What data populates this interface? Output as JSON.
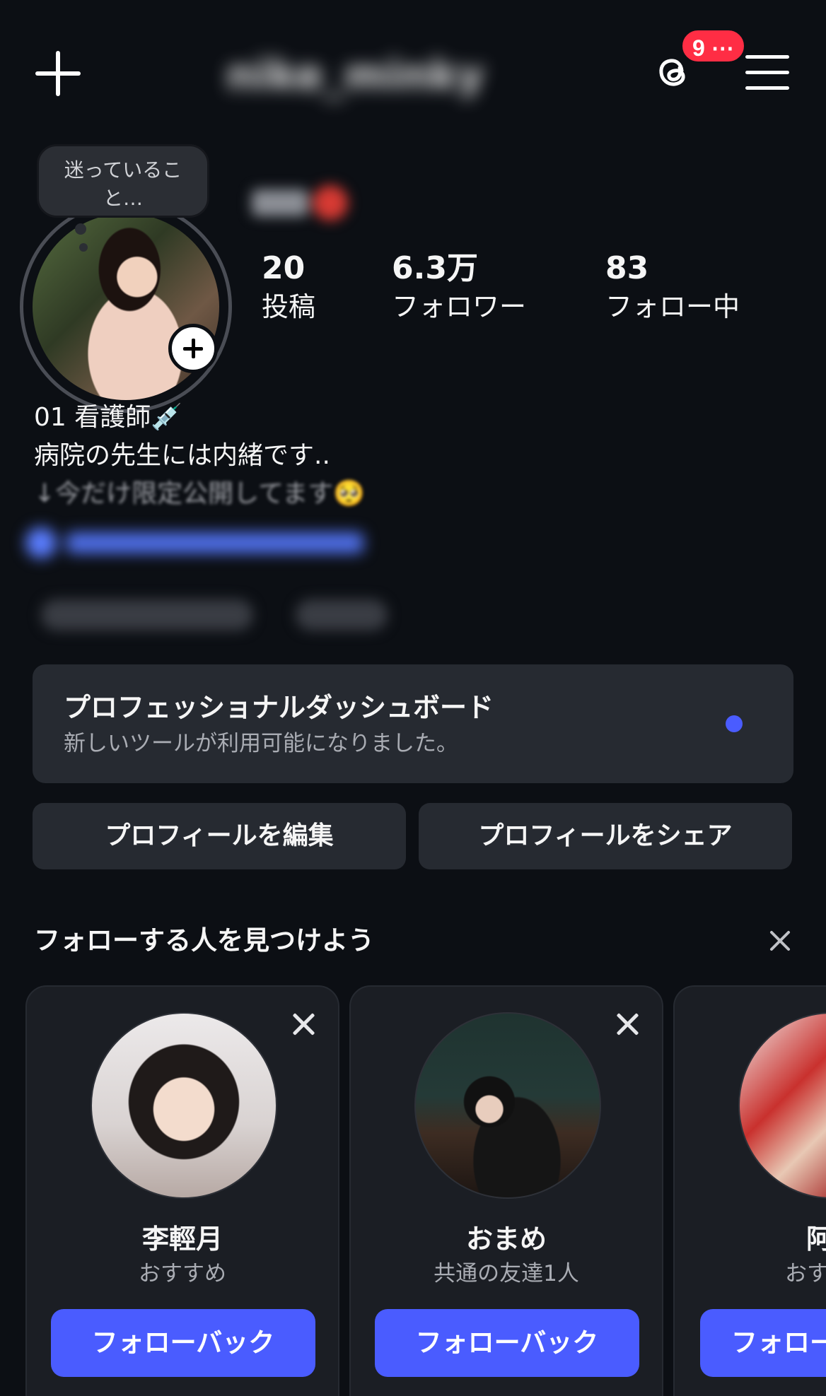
{
  "header": {
    "username": "nike_minky",
    "notification_count": "9 ⋯",
    "icons": {
      "create": "plus-icon",
      "threads": "threads-icon",
      "menu": "hamburger-menu-icon"
    }
  },
  "profile": {
    "note_text": "迷っていること…",
    "display_name": "優衣",
    "stats": [
      {
        "value": "20",
        "label": "投稿"
      },
      {
        "value": "6.3万",
        "label": "フォロワー"
      },
      {
        "value": "83",
        "label": "フォロー中"
      }
    ],
    "bio": {
      "line1": "01 看護師💉",
      "line2": "病院の先生には内緒です..",
      "line3": "↓今だけ限定公開してます🥺"
    }
  },
  "dashboard": {
    "title": "プロフェッショナルダッシュボード",
    "subtitle": "新しいツールが利用可能になりました。",
    "dot_color": "#4a5cff"
  },
  "actions": {
    "edit_profile": "プロフィールを編集",
    "share_profile": "プロフィールをシェア"
  },
  "suggestions": {
    "title": "フォローする人を見つけよう",
    "cards": [
      {
        "name": "李輕月",
        "subtitle": "おすすめ",
        "button": "フォローバック"
      },
      {
        "name": "おまめ",
        "subtitle": "共通の友達1人",
        "button": "フォローバック"
      },
      {
        "name": "阿",
        "subtitle": "おす",
        "button": "フォロー"
      }
    ]
  },
  "colors": {
    "background": "#0c0f14",
    "card": "#262a31",
    "accent": "#4a5cff",
    "badge": "#ff2d44"
  }
}
